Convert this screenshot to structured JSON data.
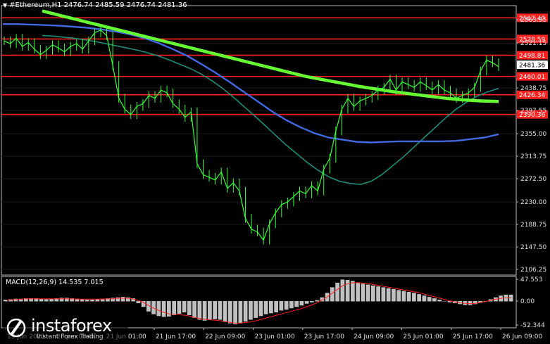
{
  "header": {
    "symbol_line": "#Ethereum,H1  2476.74 2485.59 2476.74 2481.36"
  },
  "macd_header": "MACD(12,26,9) 14.535 7.015",
  "branding": {
    "name": "instaforex",
    "tagline": "Instant Forex Trading"
  },
  "colors": {
    "background": "#000000",
    "candles": "#33ff33",
    "ma_fast": "#1e8c7a",
    "ma_mid": "#4169e1",
    "ma_slow": "#66ff33",
    "levels": "#ff2020",
    "macd_hist": "#c0c0c0",
    "macd_signal": "#ff2020"
  },
  "chart_data": {
    "type": "line",
    "title": "",
    "price_ticks": [
      "2563.95",
      "2521.15",
      "2438.75",
      "2397.55",
      "2355.00",
      "2313.75",
      "2272.50",
      "2230.00",
      "2188.75",
      "2147.50",
      "2106.25"
    ],
    "y_range": [
      2096,
      2582
    ],
    "time_ticks": [
      "19 Jun 2021",
      "20 Jun 09:00",
      "21 Jun 01:00",
      "21 Jun 17:00",
      "22 Jun 09:00",
      "23 Jun 01:00",
      "23 Jun 17:00",
      "24 Jun 09:00",
      "25 Jun 01:00",
      "25 Jun 17:00",
      "26 Jun 09:00"
    ],
    "current_price": "2481.36",
    "levels": [
      {
        "label": "2567.40",
        "value": 2567.4
      },
      {
        "label": "2528.59",
        "value": 2528.59
      },
      {
        "label": "2498.81",
        "value": 2498.81
      },
      {
        "label": "2460.01",
        "value": 2460.01
      },
      {
        "label": "2426.34",
        "value": 2426.34
      },
      {
        "label": "2390.36",
        "value": 2390.36
      }
    ],
    "close_series": [
      2525,
      2520,
      2530,
      2515,
      2522,
      2510,
      2500,
      2508,
      2518,
      2512,
      2505,
      2515,
      2520,
      2510,
      2525,
      2540,
      2545,
      2535,
      2480,
      2420,
      2400,
      2390,
      2405,
      2410,
      2425,
      2420,
      2435,
      2430,
      2410,
      2400,
      2385,
      2395,
      2300,
      2280,
      2275,
      2270,
      2285,
      2255,
      2265,
      2250,
      2200,
      2180,
      2175,
      2160,
      2190,
      2210,
      2225,
      2230,
      2240,
      2250,
      2245,
      2260,
      2250,
      2290,
      2310,
      2360,
      2400,
      2420,
      2405,
      2415,
      2420,
      2425,
      2435,
      2440,
      2455,
      2435,
      2450,
      2445,
      2440,
      2450,
      2443,
      2435,
      2445,
      2435,
      2430,
      2420,
      2425,
      2430,
      2440,
      2470,
      2490,
      2485,
      2478
    ],
    "ma_fast": [
      2535,
      2534,
      2532,
      2530,
      2527,
      2524,
      2520,
      2516,
      2512,
      2508,
      2503,
      2497,
      2490,
      2482,
      2474,
      2464,
      2452,
      2438,
      2422,
      2405,
      2388,
      2370,
      2352,
      2334,
      2318,
      2302,
      2288,
      2276,
      2268,
      2264,
      2262,
      2268,
      2280,
      2296,
      2312,
      2330,
      2348,
      2366,
      2384,
      2400,
      2413,
      2424,
      2432,
      2438
    ],
    "ma_mid": [
      2556,
      2556,
      2555,
      2554,
      2553,
      2551,
      2549,
      2546,
      2542,
      2537,
      2530,
      2521,
      2510,
      2498,
      2483,
      2467,
      2450,
      2432,
      2414,
      2396,
      2380,
      2367,
      2356,
      2348,
      2344,
      2340,
      2339,
      2340,
      2341,
      2341,
      2341,
      2341,
      2342,
      2345,
      2348,
      2354
    ],
    "ma_slow": [
      2580,
      2572,
      2564,
      2556,
      2548,
      2540,
      2532,
      2524,
      2516,
      2508,
      2500,
      2492,
      2484,
      2476,
      2468,
      2460,
      2454,
      2448,
      2442,
      2437,
      2432,
      2428,
      2424,
      2420,
      2417,
      2415,
      2414
    ],
    "macd": {
      "ticks": [
        "47.553",
        "0.00",
        "-52.344"
      ],
      "range": [
        -52.344,
        47.553
      ],
      "hist": [
        3,
        4,
        5,
        5,
        6,
        6,
        6,
        5,
        4,
        5,
        6,
        7,
        7,
        6,
        5,
        4,
        3,
        3,
        4,
        5,
        6,
        7,
        8,
        9,
        8,
        6,
        -4,
        -12,
        -22,
        -28,
        -32,
        -34,
        -33,
        -30,
        -27,
        -24,
        -30,
        -36,
        -40,
        -42,
        -40,
        -39,
        -40,
        -45,
        -48,
        -50,
        -48,
        -44,
        -40,
        -36,
        -32,
        -28,
        -26,
        -24,
        -20,
        -18,
        -15,
        -12,
        -9,
        -5,
        -2,
        2,
        8,
        18,
        30,
        40,
        47,
        46,
        44,
        40,
        38,
        36,
        34,
        32,
        30,
        28,
        26,
        24,
        22,
        20,
        18,
        15,
        12,
        9,
        6,
        3,
        0,
        -2,
        -4,
        -6,
        -8,
        -8,
        -6,
        -3,
        0,
        4,
        8,
        12,
        14,
        14
      ],
      "signal": [
        2,
        3,
        3,
        4,
        5,
        5,
        5,
        5,
        5,
        5,
        5,
        5,
        5,
        5,
        4,
        4,
        4,
        4,
        4,
        4,
        5,
        5,
        6,
        6,
        6,
        4,
        1,
        -4,
        -10,
        -16,
        -21,
        -25,
        -28,
        -29,
        -30,
        -31,
        -33,
        -36,
        -38,
        -40,
        -41,
        -42,
        -43,
        -45,
        -47,
        -48,
        -48,
        -47,
        -45,
        -43,
        -40,
        -37,
        -34,
        -31,
        -28,
        -25,
        -22,
        -19,
        -16,
        -12,
        -8,
        -3,
        3,
        10,
        18,
        26,
        34,
        38,
        40,
        40,
        39,
        38,
        36,
        34,
        32,
        30,
        28,
        26,
        24,
        22,
        20,
        18,
        15,
        12,
        9,
        6,
        3,
        0,
        -2,
        -4,
        -5,
        -6,
        -5,
        -3,
        -1,
        2,
        4,
        6,
        7,
        7
      ]
    }
  }
}
